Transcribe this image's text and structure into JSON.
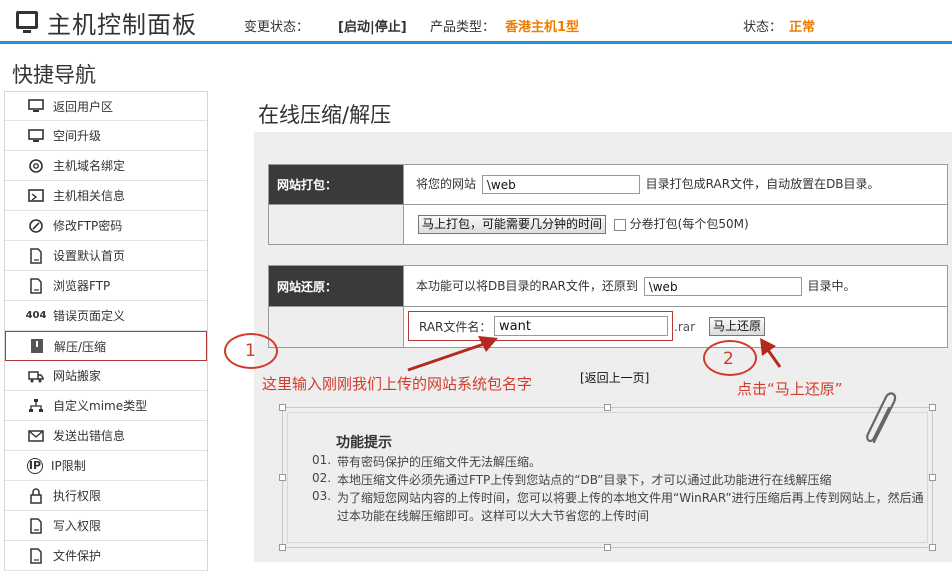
{
  "header": {
    "title": "主机控制面板",
    "change_status_label": "变更状态：",
    "change_status_value": "[启动|停止]",
    "product_type_label": "产品类型：",
    "product_type_value": "香港主机1型",
    "status_label": "状态：",
    "status_value": "正常",
    "accent_color": "#2a8fd6",
    "highlight_color": "#f07c00"
  },
  "sidebar": {
    "title": "快捷导航",
    "items": [
      {
        "label": "返回用户区",
        "icon": "monitor-icon"
      },
      {
        "label": "空间升级",
        "icon": "monitor-icon"
      },
      {
        "label": "主机域名绑定",
        "icon": "at-icon"
      },
      {
        "label": "主机相关信息",
        "icon": "info-screen-icon"
      },
      {
        "label": "修改FTP密码",
        "icon": "edit-icon"
      },
      {
        "label": "设置默认首页",
        "icon": "document-icon"
      },
      {
        "label": "浏览器FTP",
        "icon": "document-icon"
      },
      {
        "label": "错误页面定义",
        "icon": "404-icon",
        "icon_text": "404"
      },
      {
        "label": "解压/压缩",
        "icon": "archive-icon",
        "active": true
      },
      {
        "label": "网站搬家",
        "icon": "truck-icon"
      },
      {
        "label": "自定义mime类型",
        "icon": "tree-icon"
      },
      {
        "label": "发送出错信息",
        "icon": "mail-icon"
      },
      {
        "label": "IP限制",
        "icon": "ip-icon",
        "icon_text": "IP"
      },
      {
        "label": "执行权限",
        "icon": "lock-icon"
      },
      {
        "label": "写入权限",
        "icon": "document-icon"
      },
      {
        "label": "文件保护",
        "icon": "document-icon"
      }
    ]
  },
  "main": {
    "title": "在线压缩/解压",
    "pack": {
      "label": "网站打包：",
      "prefix": "将您的网站",
      "input_value": "\\web",
      "suffix": "目录打包成RAR文件，自动放置在DB目录。",
      "button_label": "马上打包，可能需要几分钟的时间",
      "split_label": "分卷打包(每个包50M)"
    },
    "restore": {
      "label": "网站还原：",
      "prefix": "本功能可以将DB目录的RAR文件，还原到",
      "input_value": "\\web",
      "suffix": "目录中。",
      "rar_label": "RAR文件名：",
      "rar_input_value": "want",
      "rar_ext": ".rar",
      "button_label": "马上还原"
    },
    "back_link": "[返回上一页]"
  },
  "tips": {
    "title": "功能提示",
    "items": [
      {
        "num": "01.",
        "text": "带有密码保护的压缩文件无法解压缩。"
      },
      {
        "num": "02.",
        "text": "本地压缩文件必须先通过FTP上传到您站点的“DB”目录下，才可以通过此功能进行在线解压缩"
      },
      {
        "num": "03.",
        "text": "为了缩短您网站内容的上传时间，您可以将要上传的本地文件用“WinRAR”进行压缩后再上传到网站上，然后通"
      },
      {
        "num": "",
        "text": "过本功能在线解压缩即可。这样可以大大节省您的上传时间"
      }
    ]
  },
  "annotations": {
    "circle1": "1",
    "circle2": "2",
    "note1": "这里输入刚刚我们上传的网站系统包名字",
    "note2": "点击“马上还原”",
    "color": "#d43a2a"
  }
}
